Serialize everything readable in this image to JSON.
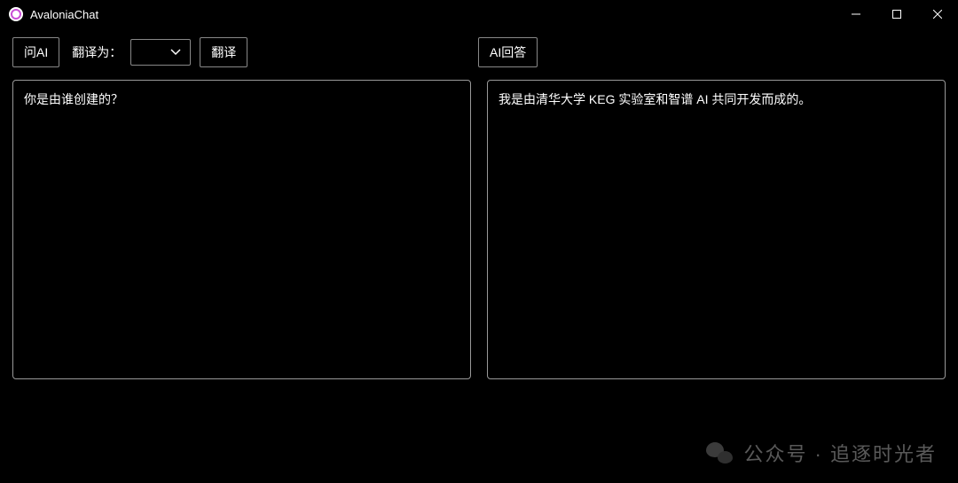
{
  "titlebar": {
    "app_title": "AvaloniaChat"
  },
  "toolbar": {
    "ask_ai_label": "问AI",
    "translate_to_label": "翻译为：",
    "translate_label": "翻译",
    "ai_answer_label": "AI回答"
  },
  "panels": {
    "left_text": "你是由谁创建的？",
    "right_text": "我是由清华大学 KEG 实验室和智谱 AI 共同开发而成的。"
  },
  "watermark": {
    "text": "公众号 · 追逐时光者"
  }
}
